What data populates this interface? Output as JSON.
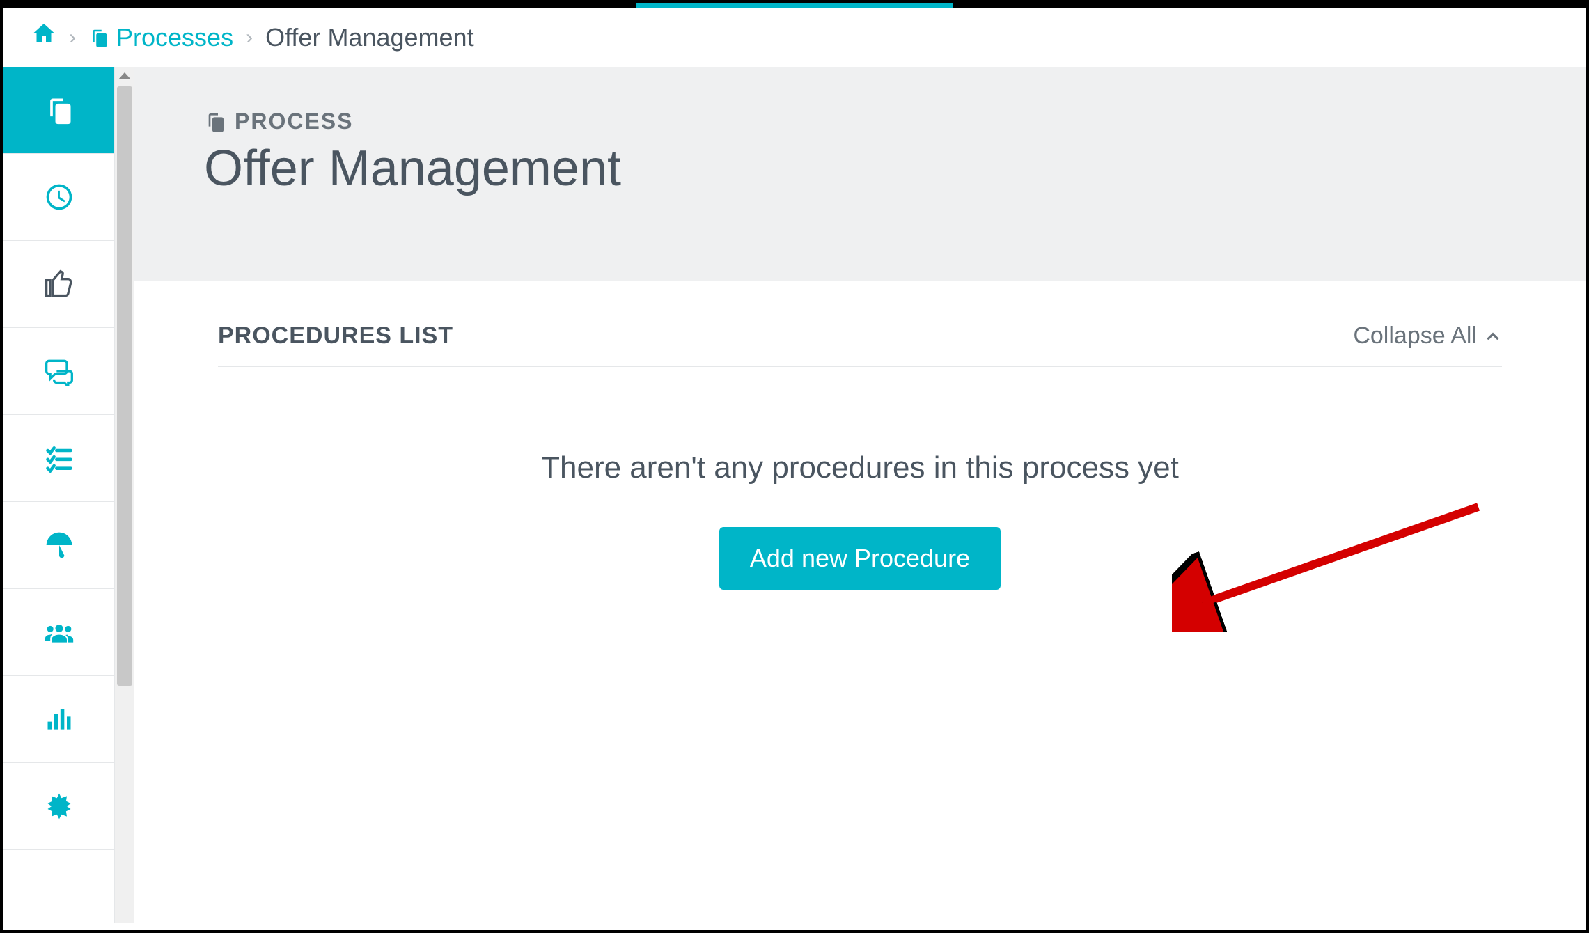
{
  "breadcrumb": {
    "processes_label": "Processes",
    "current": "Offer Management"
  },
  "header": {
    "eyebrow": "PROCESS",
    "title": "Offer Management"
  },
  "procedures": {
    "list_title": "PROCEDURES LIST",
    "collapse_label": "Collapse All",
    "empty_message": "There aren't any procedures in this process yet",
    "add_button_label": "Add new Procedure"
  },
  "sidebar": {
    "items": [
      {
        "name": "processes",
        "icon": "copy-icon",
        "active": true
      },
      {
        "name": "time",
        "icon": "clock-icon"
      },
      {
        "name": "thumbs",
        "icon": "thumbs-up-icon",
        "dark": true
      },
      {
        "name": "comments",
        "icon": "chat-icon"
      },
      {
        "name": "checklist",
        "icon": "checklist-icon"
      },
      {
        "name": "umbrella",
        "icon": "umbrella-icon"
      },
      {
        "name": "team",
        "icon": "team-icon"
      },
      {
        "name": "stats",
        "icon": "bars-icon"
      },
      {
        "name": "badge",
        "icon": "star-burst-icon"
      }
    ]
  },
  "colors": {
    "accent": "#00b5c8",
    "text_dark": "#4a5560",
    "annotation": "#d40000"
  }
}
